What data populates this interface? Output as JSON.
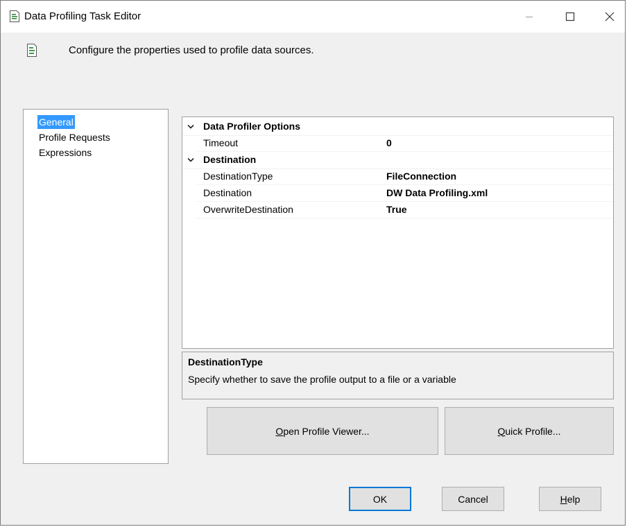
{
  "window": {
    "title": "Data Profiling Task Editor",
    "controls": [
      "minimize",
      "maximize",
      "close"
    ]
  },
  "header": {
    "text": "Configure the properties used to profile data sources."
  },
  "nav": {
    "items": [
      {
        "label": "General",
        "selected": true
      },
      {
        "label": "Profile Requests",
        "selected": false
      },
      {
        "label": "Expressions",
        "selected": false
      }
    ]
  },
  "grid": {
    "categories": [
      {
        "label": "Data Profiler Options",
        "expanded": true,
        "properties": [
          {
            "name": "Timeout",
            "value": "0"
          }
        ]
      },
      {
        "label": "Destination",
        "expanded": true,
        "properties": [
          {
            "name": "DestinationType",
            "value": "FileConnection"
          },
          {
            "name": "Destination",
            "value": "DW Data Profiling.xml"
          },
          {
            "name": "OverwriteDestination",
            "value": "True"
          }
        ]
      }
    ]
  },
  "description": {
    "title": "DestinationType",
    "text": "Specify whether to save the profile output to a file or a variable"
  },
  "buttons": {
    "open_viewer": {
      "mnemonic": "O",
      "rest": "pen Profile Viewer..."
    },
    "quick_profile": {
      "mnemonic": "Q",
      "rest": "uick Profile..."
    },
    "ok": "OK",
    "cancel": "Cancel",
    "help": {
      "mnemonic": "H",
      "rest": "elp"
    }
  },
  "colors": {
    "selection": "#3399ff",
    "dialog_bg": "#f0f0f0",
    "ok_border": "#0078d7"
  },
  "icons": {
    "title": "document-icon",
    "header": "document-icon",
    "expand": "chevron-down-icon"
  }
}
